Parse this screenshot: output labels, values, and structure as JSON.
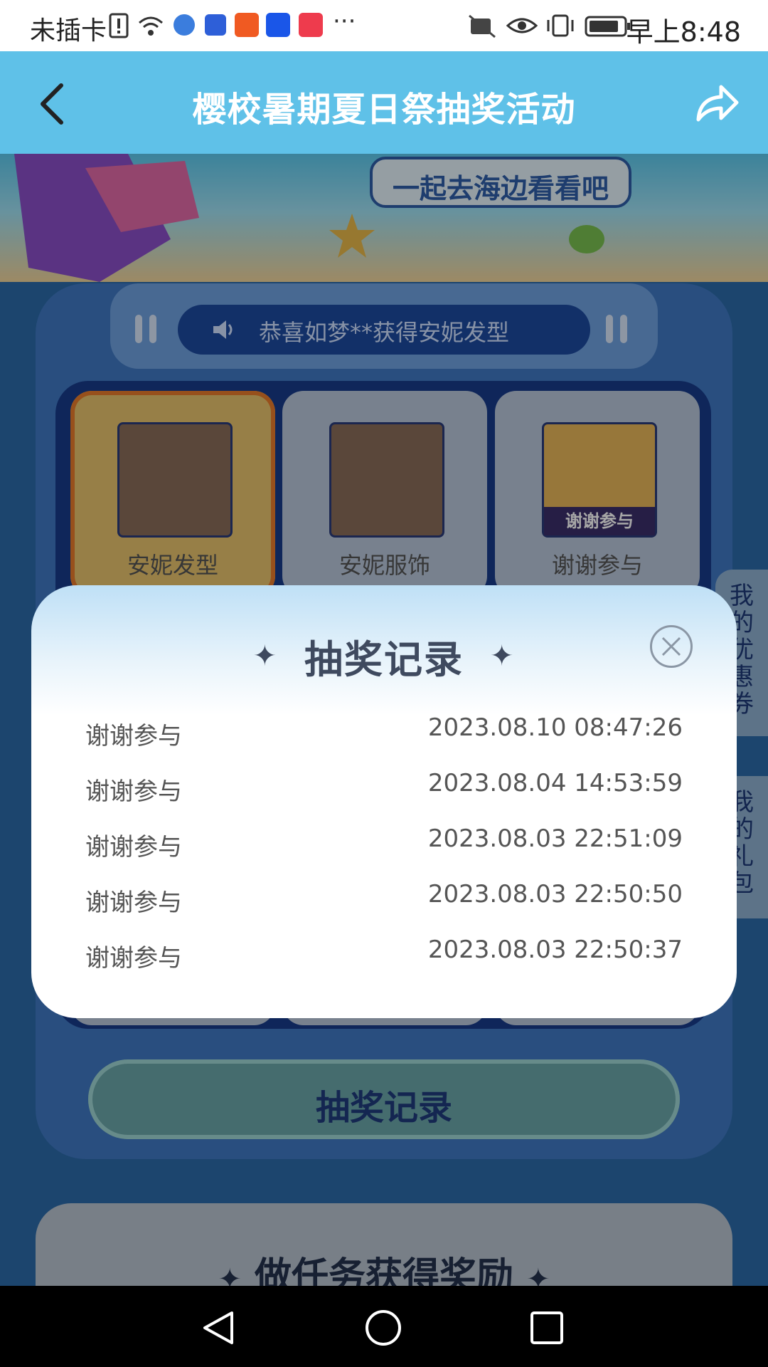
{
  "status_bar": {
    "carrier": "未插卡",
    "time": "早上8:48"
  },
  "header": {
    "title": "樱校暑期夏日祭抽奖活动"
  },
  "banner": {
    "slogan": "一起去海边看看吧"
  },
  "ticker": {
    "message": "恭喜如梦**获得安妮发型"
  },
  "prizes": [
    {
      "label": "安妮发型"
    },
    {
      "label": "安妮服饰"
    },
    {
      "label": "谢谢参与",
      "thumb_text": "谢谢参与"
    }
  ],
  "side_tabs": {
    "coupons": "我的优惠券",
    "gifts": "我的礼包"
  },
  "record_button": {
    "label": "抽奖记录"
  },
  "task_section": {
    "title": "做任务获得奖励"
  },
  "modal": {
    "title": "抽奖记录",
    "records": [
      {
        "name": "谢谢参与",
        "time": "2023.08.10 08:47:26"
      },
      {
        "name": "谢谢参与",
        "time": "2023.08.04 14:53:59"
      },
      {
        "name": "谢谢参与",
        "time": "2023.08.03 22:51:09"
      },
      {
        "name": "谢谢参与",
        "time": "2023.08.03 22:50:50"
      },
      {
        "name": "谢谢参与",
        "time": "2023.08.03 22:50:37"
      }
    ]
  },
  "colors": {
    "header": "#5fc1e8",
    "selected_card": "#e8c46d",
    "accent_border": "#e87b2c",
    "modal_title": "#3f4a5f"
  }
}
